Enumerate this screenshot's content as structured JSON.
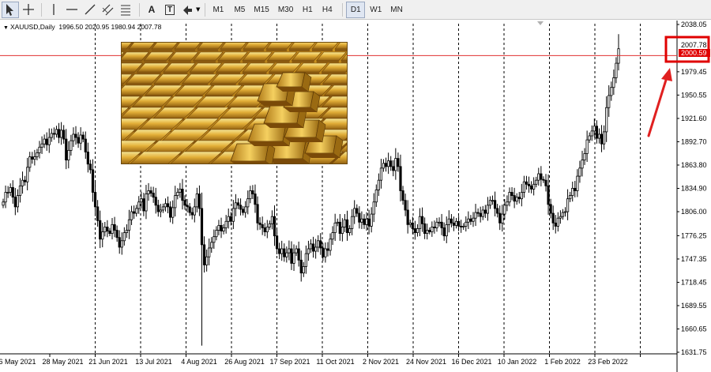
{
  "toolbar": {
    "tools": [
      {
        "name": "cursor-tool",
        "glyph": "cursor"
      },
      {
        "name": "crosshair-tool",
        "glyph": "crosshair"
      },
      {
        "name": "vertical-line-tool",
        "glyph": "vline"
      },
      {
        "name": "horizontal-line-tool",
        "glyph": "hline"
      },
      {
        "name": "trendline-tool",
        "glyph": "trend"
      },
      {
        "name": "equidistant-channel-tool",
        "glyph": "channel"
      },
      {
        "name": "fibonacci-tool",
        "glyph": "fib"
      },
      {
        "name": "text-tool",
        "label": "A"
      },
      {
        "name": "text-label-tool",
        "label": "T"
      },
      {
        "name": "arrows-tool",
        "glyph": "arrows"
      }
    ],
    "timeframes": [
      "M1",
      "M5",
      "M15",
      "M30",
      "H1",
      "H4",
      "D1",
      "W1",
      "MN"
    ],
    "active_timeframe": "D1"
  },
  "symbol": {
    "name": "XAUUSD,Daily",
    "ohlc": "1996.50 2020.95 1980.94 2007.78"
  },
  "colors": {
    "candle": "#000000",
    "price_line": "#e03030",
    "price_tag": "#e00000",
    "highlight_box": "#e00000",
    "arrow": "#e02020",
    "grid": "#000000"
  },
  "chart_data": {
    "type": "candlestick",
    "y_axis_ticks": [
      "2038.05",
      "2007.78",
      "1979.45",
      "1950.55",
      "1921.60",
      "1892.70",
      "1863.80",
      "1834.90",
      "1806.00",
      "1776.25",
      "1747.35",
      "1718.45",
      "1689.55",
      "1660.65",
      "1631.75"
    ],
    "ylim": [
      1631.75,
      2038.05
    ],
    "x_axis_ticks": [
      "6 May 2021",
      "28 May 2021",
      "21 Jun 2021",
      "13 Jul 2021",
      "4 Aug 2021",
      "26 Aug 2021",
      "17 Sep 2021",
      "11 Oct 2021",
      "2 Nov 2021",
      "24 Nov 2021",
      "16 Dec 2021",
      "10 Jan 2022",
      "1 Feb 2022",
      "23 Feb 2022"
    ],
    "current_price": "2007.78",
    "bid_price": "2000.59",
    "close_series": [
      1818,
      1830,
      1830,
      1836,
      1824,
      1812,
      1826,
      1838,
      1845,
      1843,
      1861,
      1874,
      1871,
      1874,
      1879,
      1886,
      1890,
      1896,
      1889,
      1898,
      1903,
      1902,
      1908,
      1898,
      1907,
      1896,
      1870,
      1882,
      1894,
      1902,
      1898,
      1891,
      1901,
      1896,
      1880,
      1865,
      1858,
      1830,
      1812,
      1795,
      1772,
      1781,
      1787,
      1782,
      1779,
      1790,
      1783,
      1774,
      1762,
      1770,
      1780,
      1783,
      1796,
      1806,
      1804,
      1810,
      1818,
      1822,
      1807,
      1828,
      1832,
      1829,
      1824,
      1814,
      1806,
      1808,
      1812,
      1816,
      1812,
      1799,
      1811,
      1826,
      1830,
      1834,
      1820,
      1814,
      1812,
      1805,
      1802,
      1812,
      1828,
      1810,
      1765,
      1740,
      1750,
      1761,
      1768,
      1775,
      1783,
      1789,
      1782,
      1786,
      1794,
      1800,
      1794,
      1810,
      1817,
      1814,
      1809,
      1805,
      1812,
      1822,
      1832,
      1828,
      1815,
      1792,
      1790,
      1786,
      1781,
      1787,
      1791,
      1800,
      1776,
      1760,
      1754,
      1760,
      1750,
      1755,
      1760,
      1742,
      1755,
      1760,
      1746,
      1730,
      1738,
      1754,
      1760,
      1766,
      1757,
      1762,
      1770,
      1761,
      1750,
      1760,
      1758,
      1772,
      1780,
      1792,
      1793,
      1779,
      1787,
      1796,
      1780,
      1785,
      1800,
      1810,
      1804,
      1793,
      1797,
      1790,
      1797,
      1788,
      1803,
      1818,
      1833,
      1845,
      1860,
      1866,
      1862,
      1869,
      1862,
      1857,
      1872,
      1862,
      1832,
      1820,
      1808,
      1790,
      1792,
      1785,
      1780,
      1785,
      1800,
      1791,
      1779,
      1783,
      1781,
      1787,
      1786,
      1793,
      1793,
      1786,
      1776,
      1790,
      1797,
      1792,
      1789,
      1794,
      1788,
      1787,
      1788,
      1793,
      1797,
      1794,
      1798,
      1805,
      1804,
      1800,
      1808,
      1804,
      1814,
      1820,
      1820,
      1810,
      1804,
      1792,
      1803,
      1814,
      1818,
      1830,
      1826,
      1819,
      1824,
      1822,
      1830,
      1843,
      1840,
      1838,
      1834,
      1840,
      1845,
      1853,
      1846,
      1845,
      1838,
      1815,
      1804,
      1792,
      1788,
      1798,
      1800,
      1805,
      1806,
      1822,
      1826,
      1835,
      1832,
      1850,
      1860,
      1870,
      1878,
      1895,
      1900,
      1906,
      1912,
      1897,
      1902,
      1890,
      1905,
      1935,
      1950,
      1960,
      1972,
      1990,
      2008
    ]
  }
}
